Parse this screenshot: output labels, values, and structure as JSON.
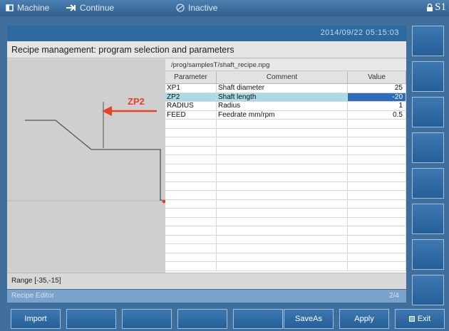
{
  "topbar": {
    "machine": "Machine",
    "continue": "Continue",
    "inactive": "Inactive",
    "channel": "S1"
  },
  "datetime": "2014/09/22  05:15:03",
  "panel": {
    "title": "Recipe management: program selection and parameters",
    "path": "/prog/samplesT/shaft_recipe.npg",
    "graphic_label": "ZP2",
    "columns": {
      "parameter": "Parameter",
      "comment": "Comment",
      "value": "Value"
    },
    "rows": [
      {
        "parameter": "XP1",
        "comment": "Shaft diameter",
        "value": "25"
      },
      {
        "parameter": "ZP2",
        "comment": "Shaft length",
        "value": "-20"
      },
      {
        "parameter": "RADIUS",
        "comment": "Radius",
        "value": "1"
      },
      {
        "parameter": "FEED",
        "comment": "Feedrate mm/rpm",
        "value": "0.5"
      }
    ],
    "range": "Range [-35,-15]"
  },
  "status": {
    "editor": "Recipe Editor",
    "page": "2/4"
  },
  "softkeys": {
    "import": "Import",
    "saveas": "SaveAs",
    "apply": "Apply",
    "exit": "Exit"
  },
  "colors": {
    "accent": "#2f6db8",
    "selected_row": "#a9dbe6",
    "arrow": "#e8402a",
    "marker": "#e23b2f"
  }
}
